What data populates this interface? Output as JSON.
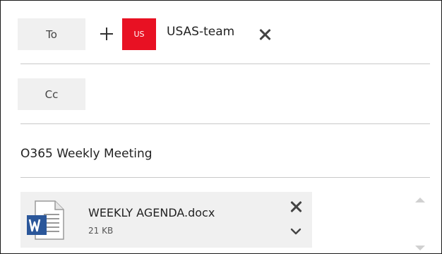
{
  "to_field": {
    "label": "To",
    "add_icon": "plus-icon",
    "recipients": [
      {
        "initials": "US",
        "name": "USAS-team",
        "avatar_color": "#e81123",
        "remove_icon": "close-icon"
      }
    ]
  },
  "cc_field": {
    "label": "Cc"
  },
  "subject": {
    "value": "O365 Weekly Meeting"
  },
  "attachments": [
    {
      "file_name": "WEEKLY AGENDA.docx",
      "file_size": "21 KB",
      "icon": "word-document-icon",
      "remove_icon": "close-icon",
      "menu_icon": "chevron-down-icon"
    }
  ],
  "scrollbar": {
    "up_icon": "scroll-up-arrow-icon",
    "down_icon": "scroll-down-arrow-icon"
  },
  "colors": {
    "accent": "#e81123",
    "word_blue": "#2b579a",
    "field_bg": "#f0f0f0"
  }
}
